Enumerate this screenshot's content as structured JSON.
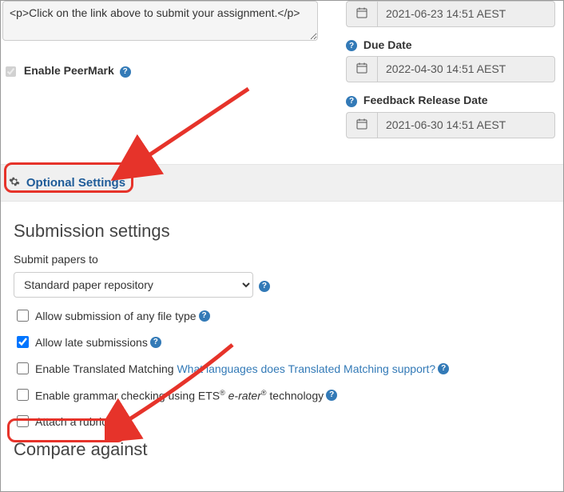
{
  "instructions_value": "<p>Click on the link above to submit your assignment.</p>",
  "peermark": {
    "label": "Enable PeerMark",
    "checked": true
  },
  "dates": {
    "start": {
      "value": "2021-06-23 14:51 AEST"
    },
    "due": {
      "label": "Due Date",
      "value": "2022-04-30 14:51 AEST"
    },
    "release": {
      "label": "Feedback Release Date",
      "value": "2021-06-30 14:51 AEST"
    }
  },
  "optional_settings_label": "Optional Settings",
  "submission": {
    "heading": "Submission settings",
    "submit_to_label": "Submit papers to",
    "repo_options": [
      "Standard paper repository"
    ],
    "repo_selected": "Standard paper repository",
    "checks": {
      "any_file": {
        "label": "Allow submission of any file type",
        "checked": false
      },
      "late": {
        "label": "Allow late submissions",
        "checked": true
      },
      "translated": {
        "label": "Enable Translated Matching",
        "link": "What languages does Translated Matching support?",
        "checked": false
      },
      "grammar": {
        "prefix": "Enable grammar checking using ETS",
        "ital": "e-rater",
        "suffix": " technology",
        "checked": false
      },
      "rubric": {
        "label": "Attach a rubric",
        "checked": false
      }
    }
  },
  "compare_heading": "Compare against"
}
